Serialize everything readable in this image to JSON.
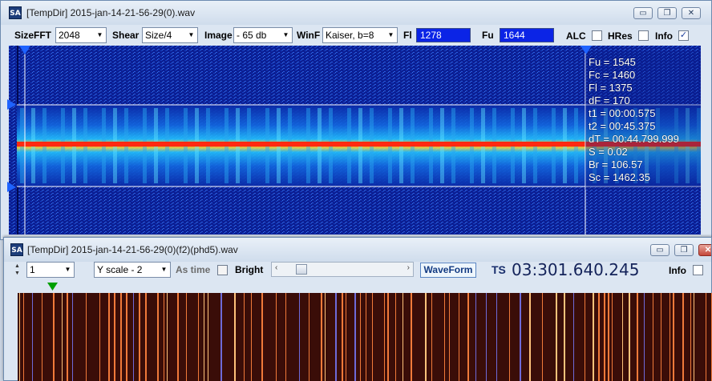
{
  "window1": {
    "title": "[TempDir] 2015-jan-14-21-56-29(0).wav",
    "app_icon": "SA",
    "toolbar": {
      "sizefft_label": "SizeFFT",
      "sizefft_value": "2048",
      "shear_label": "Shear",
      "shear_value": "Size/4",
      "image_label": "Image",
      "image_value": "- 65 db",
      "winf_label": "WinF",
      "winf_value": "Kaiser, b=8",
      "fl_label": "Fl",
      "fl_value": "1278",
      "fu_label": "Fu",
      "fu_value": "1644",
      "alc_label": "ALC",
      "alc_checked": false,
      "hres_label": "HRes",
      "hres_checked": false,
      "info_label": "Info",
      "info_checked": true
    },
    "readout": [
      "Fu = 1545",
      "Fc = 1460",
      "Fl = 1375",
      "dF = 170",
      "t1 = 00:00.575",
      "t2 = 00:45.375",
      "dT = 00:44.799.999",
      "S = 0.02",
      "Br = 106.57",
      "Sc = 1462.35"
    ]
  },
  "window2": {
    "title": "[TempDir] 2015-jan-14-21-56-29(0)(f2)(phd5).wav",
    "app_icon": "SA",
    "toolbar": {
      "spin_value": "1",
      "yscale_value": "Y scale - 2",
      "as_time_label": "As time",
      "as_time_checked": false,
      "bright_label": "Bright",
      "waveform_label": "WaveForm",
      "ts_label": "TS",
      "ts_value": "03:301.640.245",
      "info_label": "Info",
      "info_checked": false
    }
  },
  "window_controls": {
    "minimize": "▭",
    "restore": "❐",
    "close": "✕"
  },
  "icons": [
    "minimize-icon",
    "restore-icon",
    "close-icon",
    "dropdown-arrow-icon",
    "spin-up-icon",
    "spin-down-icon",
    "check-icon",
    "marker-triangle-icon",
    "scroll-left-icon",
    "scroll-right-icon"
  ],
  "colors": {
    "field_blue": "#0b24e6",
    "spectrogram_bg": "#0a1d8c",
    "signal_band": "#ff3b1f",
    "marker": "#1e63ff",
    "wave_green_marker": "#00a000"
  }
}
